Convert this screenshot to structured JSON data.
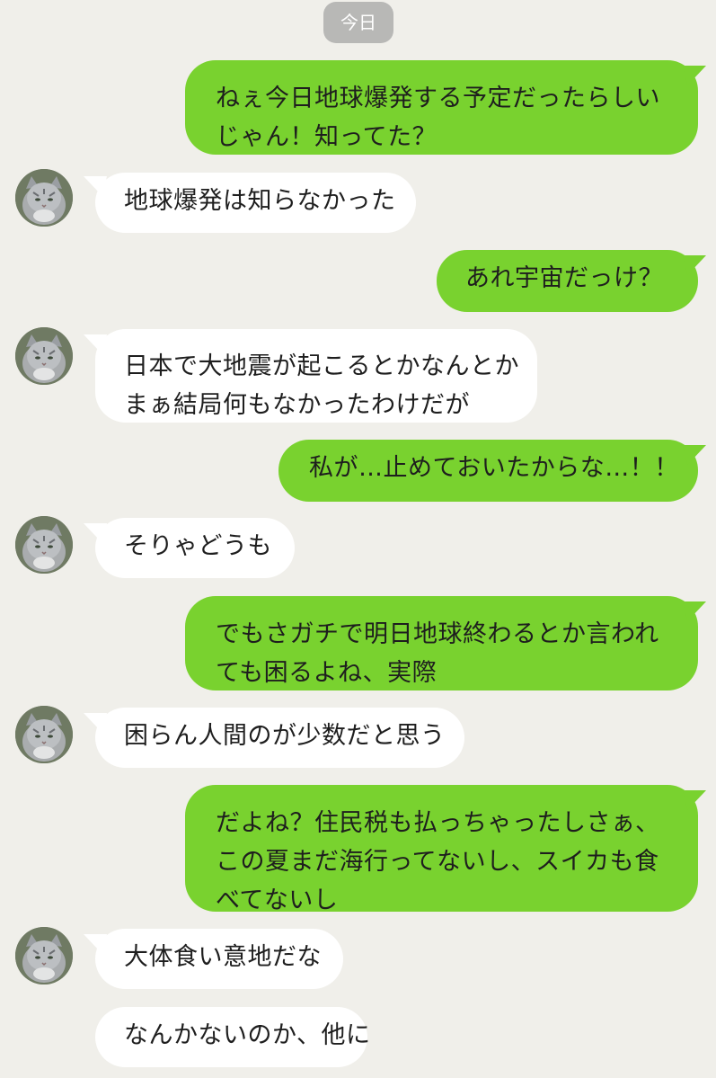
{
  "date_separator": "今日",
  "messages": [
    {
      "side": "sent",
      "lines": [
        "ねぇ今日地球爆発する予定だったらしい",
        "じゃん！知ってた？"
      ]
    },
    {
      "side": "received",
      "lines": [
        "地球爆発は知らなかった"
      ]
    },
    {
      "side": "sent",
      "lines": [
        "あれ宇宙だっけ？"
      ]
    },
    {
      "side": "received",
      "lines": [
        "日本で大地震が起こるとかなんとか",
        "まぁ結局何もなかったわけだが"
      ]
    },
    {
      "side": "sent",
      "lines": [
        "私が…止めておいたからな…！！"
      ]
    },
    {
      "side": "received",
      "lines": [
        "そりゃどうも"
      ]
    },
    {
      "side": "sent",
      "lines": [
        "でもさガチで明日地球終わるとか言われ",
        "ても困るよね、実際"
      ]
    },
    {
      "side": "received",
      "lines": [
        "困らん人間のが少数だと思う"
      ]
    },
    {
      "side": "sent",
      "lines": [
        "だよね？住民税も払っちゃったしさぁ、",
        "この夏まだ海行ってないし、スイカも食",
        "べてないし"
      ]
    },
    {
      "side": "received",
      "lines": [
        "大体食い意地だな"
      ]
    },
    {
      "side": "received",
      "lines": [
        "なんかないのか、他に"
      ]
    }
  ],
  "colors": {
    "background": "#f0efea",
    "sent_bubble": "#79d22f",
    "received_bubble": "#ffffff",
    "date_pill": "#b8b8b6"
  },
  "icons": {
    "avatar": "cat-avatar-icon"
  }
}
